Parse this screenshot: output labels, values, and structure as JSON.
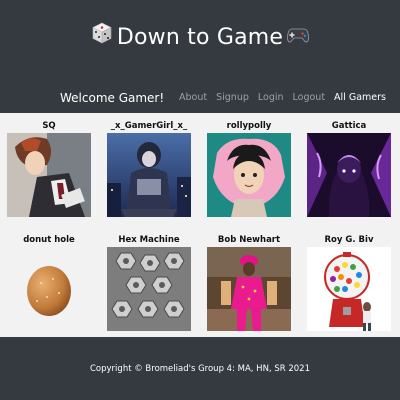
{
  "header": {
    "title": "Down to Game",
    "left_icon": "dice-icon",
    "right_icon": "game-controller-icon"
  },
  "nav": {
    "welcome": "Welcome Gamer!",
    "links": [
      "About",
      "Signup",
      "Login",
      "Logout",
      "All Gamers"
    ],
    "active": "All Gamers"
  },
  "gamers": [
    {
      "name": "SQ"
    },
    {
      "name": "_x_GamerGirl_x_"
    },
    {
      "name": "rollypolly"
    },
    {
      "name": "Gattica"
    },
    {
      "name": "donut hole"
    },
    {
      "name": "Hex Machine"
    },
    {
      "name": "Bob Newhart"
    },
    {
      "name": "Roy G. Biv"
    }
  ],
  "footer": {
    "copyright": "Copyright © Bromeliad's Group 4: MA, HN, SR 2021"
  },
  "colors": {
    "dark": "#343a40",
    "content_bg": "#f2f2f2",
    "nav_muted": "#9aa0a6"
  }
}
